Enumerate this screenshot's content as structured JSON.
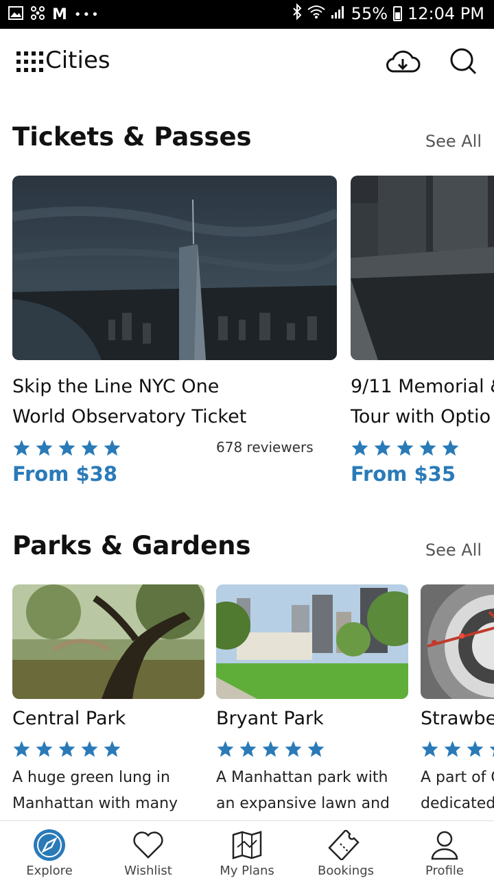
{
  "status_bar": {
    "battery": "55%",
    "time": "12:04 PM",
    "left_icons": [
      "image-icon",
      "pinwheel-icon",
      "gmail-icon",
      "more-dots-icon"
    ],
    "right_icons": [
      "bluetooth-icon",
      "wifi-icon",
      "signal-icon",
      "battery-icon"
    ]
  },
  "app_bar": {
    "title": "Cities",
    "icons": [
      "download-cloud-icon",
      "search-icon"
    ]
  },
  "sections": [
    {
      "title": "Tickets & Passes",
      "see_all": "See All",
      "cards": [
        {
          "title_line1": "Skip the Line NYC One",
          "title_line2": "World Observatory Ticket",
          "rating": 5,
          "reviewers": "678 reviewers",
          "price": "From $38"
        },
        {
          "title_line1": "9/11 Memorial &",
          "title_line2": "Tour with Optio",
          "rating": 5,
          "price": "From $35"
        }
      ]
    },
    {
      "title": "Parks & Gardens",
      "see_all": "See All",
      "cards": [
        {
          "title": "Central Park",
          "rating": 5,
          "desc_line1": "A huge green lung in",
          "desc_line2": "Manhattan with many"
        },
        {
          "title": "Bryant Park",
          "rating": 5,
          "desc_line1": "A Manhattan park with",
          "desc_line2": "an expansive lawn and"
        },
        {
          "title": "Strawbe",
          "rating": 5,
          "desc_line1": "A part of C",
          "desc_line2": "dedicated"
        }
      ]
    }
  ],
  "bottom_nav": [
    {
      "label": "Explore",
      "icon": "compass-icon",
      "active": true
    },
    {
      "label": "Wishlist",
      "icon": "heart-icon",
      "active": false
    },
    {
      "label": "My Plans",
      "icon": "map-icon",
      "active": false
    },
    {
      "label": "Bookings",
      "icon": "ticket-icon",
      "active": false
    },
    {
      "label": "Profile",
      "icon": "person-icon",
      "active": false
    }
  ],
  "colors": {
    "accent": "#2a7ab8",
    "star": "#2a7ab8",
    "status_bar": "#000000"
  }
}
